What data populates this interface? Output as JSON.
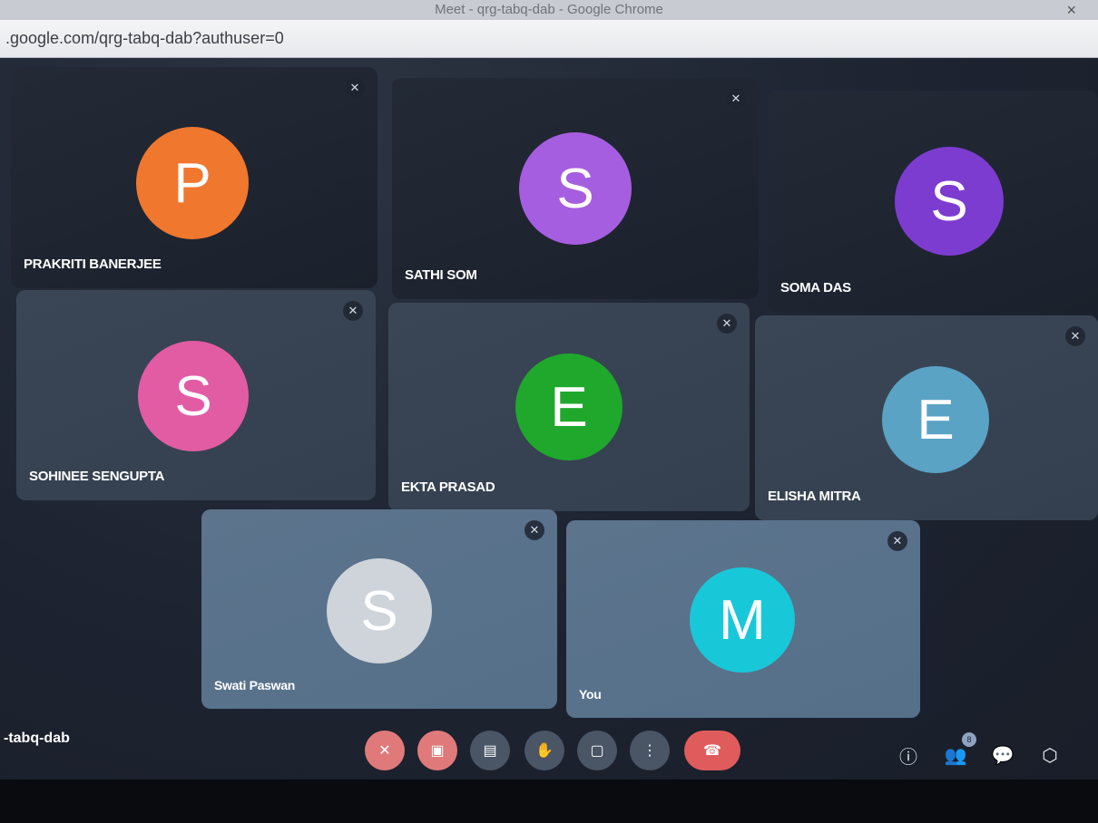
{
  "window": {
    "title": "Meet - qrg-tabq-dab - Google Chrome",
    "close_glyph": "×"
  },
  "browser": {
    "url": ".google.com/qrg-tabq-dab?authuser=0"
  },
  "participants": [
    {
      "name": "PRAKRITI BANERJEE",
      "initial": "P",
      "color": "#f0772e",
      "muted": true
    },
    {
      "name": "SATHI SOM",
      "initial": "S",
      "color": "#a65ee0",
      "muted": true
    },
    {
      "name": "SOMA DAS",
      "initial": "S",
      "color": "#7d3cd0",
      "muted": false
    },
    {
      "name": "SOHINEE SENGUPTA",
      "initial": "S",
      "color": "#e25ca4",
      "muted": true
    },
    {
      "name": "EKTA PRASAD",
      "initial": "E",
      "color": "#1fa82c",
      "muted": true
    },
    {
      "name": "ELISHA MITRA",
      "initial": "E",
      "color": "#5aa3c4",
      "muted": true
    },
    {
      "name": "Swati Paswan",
      "initial": "S",
      "color": "#cfd4da",
      "muted": true
    },
    {
      "name": "You",
      "initial": "M",
      "color": "#19c8d8",
      "muted": true
    }
  ],
  "meeting": {
    "code": "-tabq-dab"
  },
  "controls": {
    "mic": "mic-off",
    "camera": "camera-off",
    "captions": "captions",
    "raise_hand": "raise-hand",
    "present": "present-screen",
    "more": "more-options",
    "leave": "end-call"
  },
  "right_panel": {
    "people_count": "8"
  },
  "icons": {
    "muted_glyph": "🎙",
    "info": "ⓘ",
    "people": "👥",
    "chat": "💬",
    "activities": "⬡"
  },
  "colors": {
    "accent_red": "#e05c5c",
    "tile_dark": "#1f2531",
    "tile_light": "#5c748c"
  }
}
